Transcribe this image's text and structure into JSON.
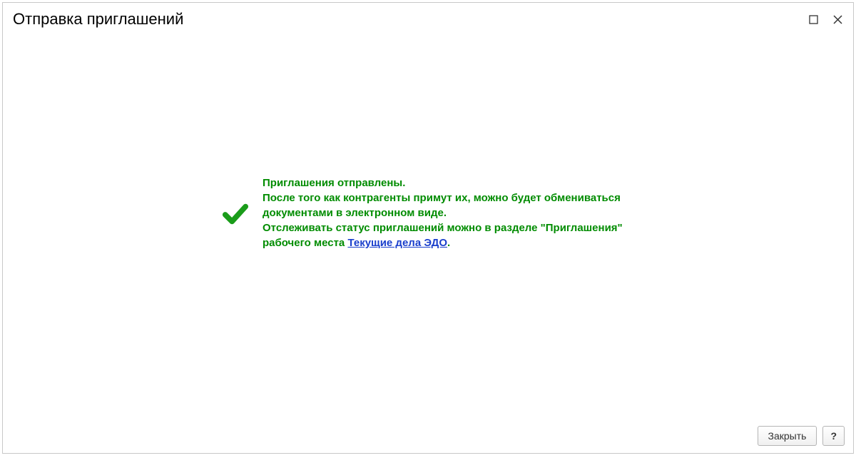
{
  "window": {
    "title": "Отправка приглашений"
  },
  "message": {
    "line1": "Приглашения отправлены.",
    "line2": "После того как контрагенты примут их, можно будет обмениваться документами в электронном виде.",
    "line3a": "Отслеживать статус приглашений можно в разделе \"Приглашения\" рабочего места ",
    "link": "Текущие дела ЭДО",
    "line3b": "."
  },
  "footer": {
    "close_label": "Закрыть",
    "help_label": "?"
  }
}
